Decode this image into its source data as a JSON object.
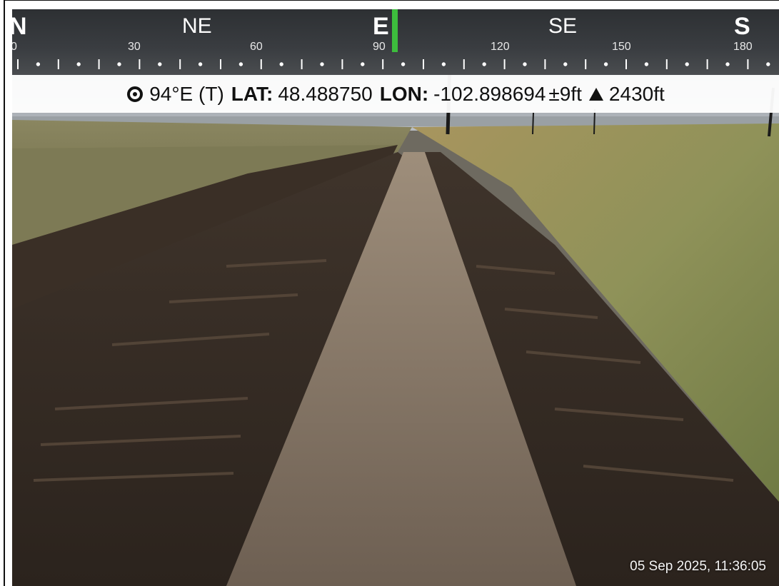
{
  "compass": {
    "directions": [
      {
        "label": "N",
        "major": true
      },
      {
        "label": "NE",
        "major": false
      },
      {
        "label": "E",
        "major": true
      },
      {
        "label": "SE",
        "major": false
      },
      {
        "label": "S",
        "major": true
      }
    ],
    "degrees": [
      "0",
      "30",
      "60",
      "90",
      "120",
      "150",
      "180"
    ]
  },
  "coordinates": {
    "heading": "94°E (T)",
    "lat_label": "LAT:",
    "lat_value": "48.488750",
    "lon_label": "LON:",
    "lon_value": "-102.898694",
    "accuracy": "±9ft",
    "altitude": "2430ft"
  },
  "timestamp": "05 Sep 2025, 11:36:05",
  "colors": {
    "heading_marker": "#3dbd3d"
  }
}
